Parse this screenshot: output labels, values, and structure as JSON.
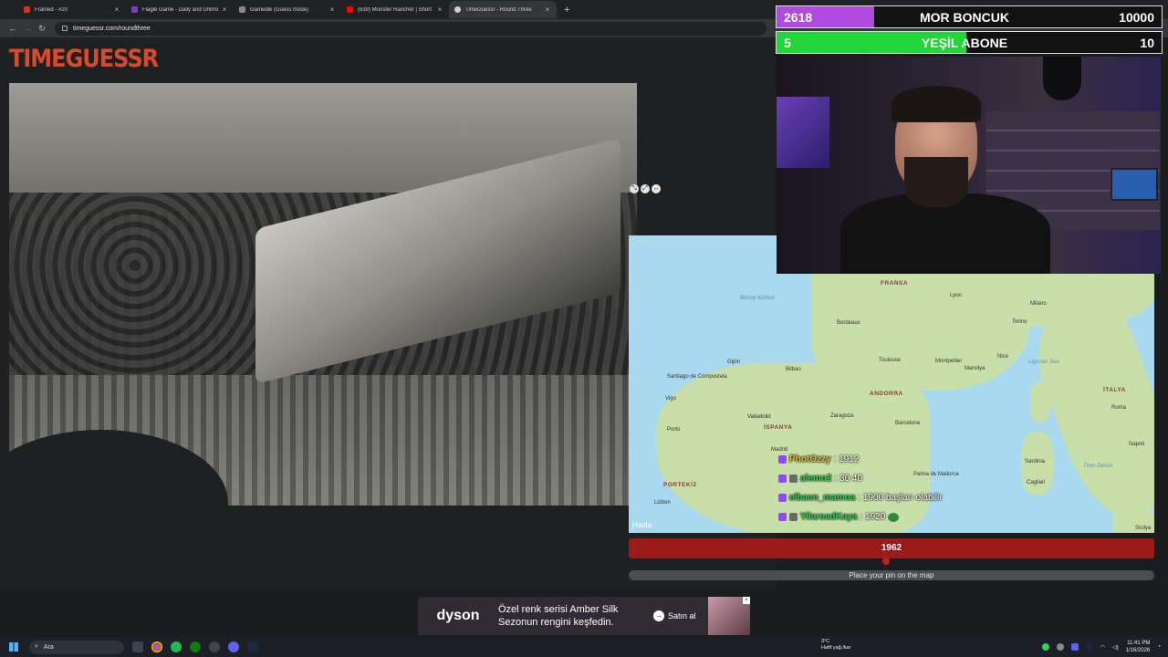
{
  "browser": {
    "tabs": [
      {
        "title": "Framed - #20",
        "color": "#d93025"
      },
      {
        "title": "Flagle Game - Daily and Unlimi",
        "color": "#7b3fbf"
      },
      {
        "title": "Gamedle (Guess mode)",
        "color": "#888888"
      },
      {
        "title": "(639) Monster Rancher | Short",
        "color": "#ff0000"
      },
      {
        "title": "TimeGuessr - Round Three",
        "color": "#cfcfcf"
      }
    ],
    "close_glyph": "×",
    "new_tab_glyph": "+",
    "url": "timeguessr.com/roundthree"
  },
  "page": {
    "logo": "TIMEGUESSR",
    "guess_year": "1962",
    "place_pin": "Place your pin on the map",
    "map_attribution": "Harita"
  },
  "map": {
    "labels": {
      "fransa": "FRANSA",
      "ispanya": "İSPANYA",
      "portekiz": "PORTEKİZ",
      "italya": "İTALYA",
      "andorra": "ANDORRA",
      "bordeaux": "Bordeaux",
      "lyon": "Lyon",
      "milano": "Milano",
      "torino": "Torino",
      "toulouse": "Toulouse",
      "montpellier": "Montpellier",
      "marsilya": "Marsilya",
      "nice": "Nice",
      "barcelona": "Barcelona",
      "zaragoza": "Zaragoza",
      "madrid": "Madrid",
      "valladolid": "Valladolid",
      "bilbao": "Bilbao",
      "gijon": "Gijón",
      "santiago": "Santiago de Compostela",
      "vigo": "Vigo",
      "porto": "Porto",
      "lizbon": "Lizbon",
      "palma": "Palma de Mallorca",
      "sardinia": "Sardinia",
      "cagliari": "Cagliari",
      "roma": "Roma",
      "napoli": "Napoli",
      "ligurian": "Ligurian Sea",
      "biscay": "Biscay Körfezi",
      "tiren": "Tiren Denizi",
      "sicilya": "Sicilya"
    }
  },
  "chat": [
    {
      "user": "PhotOzzy",
      "msg": ": 1912",
      "color": "#e0c040"
    },
    {
      "user": "alemo2",
      "msg": ": 30 40",
      "color": "#2fd15a"
    },
    {
      "user": "elbaen_mamoa",
      "msg": ": 1900 başları olabilir",
      "color": "#2fd15a"
    },
    {
      "user": "YilarsadKaya",
      "msg": ": 1920",
      "color": "#2fd15a"
    }
  ],
  "scoreboard": [
    {
      "left": "2618",
      "name": "MOR BONCUK",
      "right": "10000",
      "color": "#b04be0",
      "fill": 0.26
    },
    {
      "left": "5",
      "name": "YEŞİL ABONE",
      "right": "10",
      "color": "#22d63a",
      "fill": 0.5
    }
  ],
  "ad": {
    "brand": "dyson",
    "line1": "Özel renk serisi Amber Silk",
    "line2": "Sezonun rengini keşfedin.",
    "cta": "Satın al",
    "close": "×"
  },
  "taskbar": {
    "search": "Ara",
    "weather_temp": "3°C",
    "weather_desc": "Hafif yağ./kar",
    "time": "11:41 PM",
    "date": "1/16/2026"
  }
}
